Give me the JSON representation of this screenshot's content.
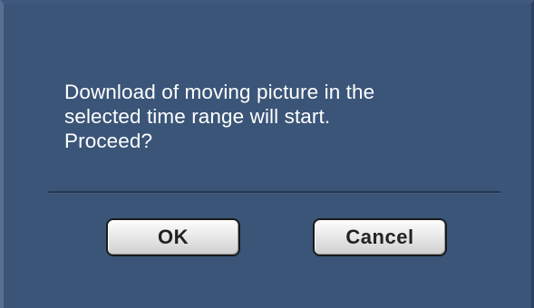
{
  "dialog": {
    "message_lines": [
      "Download of moving picture in the",
      "selected time range will start.",
      "Proceed?"
    ],
    "ok_label": "OK",
    "cancel_label": "Cancel"
  },
  "colors": {
    "background": "#3a5578",
    "text": "#ffffff",
    "divider": "#243650",
    "button_face": "#e9e9e9"
  }
}
